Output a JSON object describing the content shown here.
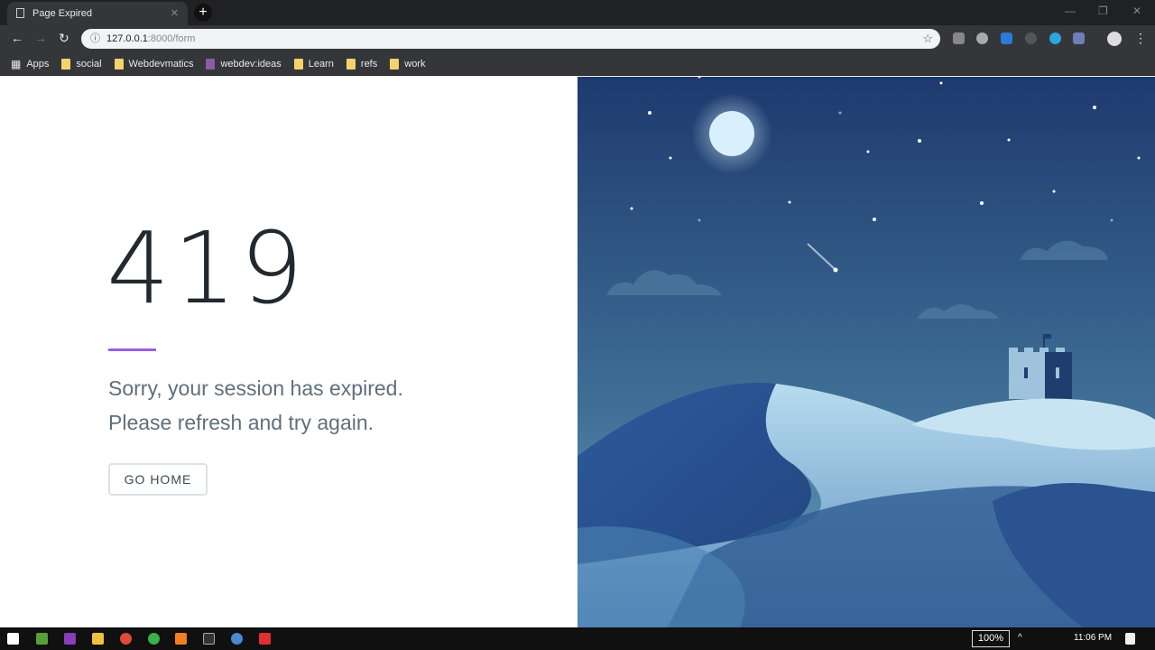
{
  "browser": {
    "tab_title": "Page Expired",
    "url_host": "127.0.0.1",
    "url_rest": ":8000/form",
    "bookmarks": [
      "Apps",
      "social",
      "Webdevmatics",
      "webdev:ideas",
      "Learn",
      "refs",
      "work"
    ]
  },
  "page": {
    "code": "419",
    "line1": "Sorry, your session has expired.",
    "line2": "Please refresh and try again.",
    "button": "GO HOME",
    "accent": "#9561e2"
  },
  "taskbar": {
    "zoom": "100%",
    "time": "11:06 PM"
  }
}
